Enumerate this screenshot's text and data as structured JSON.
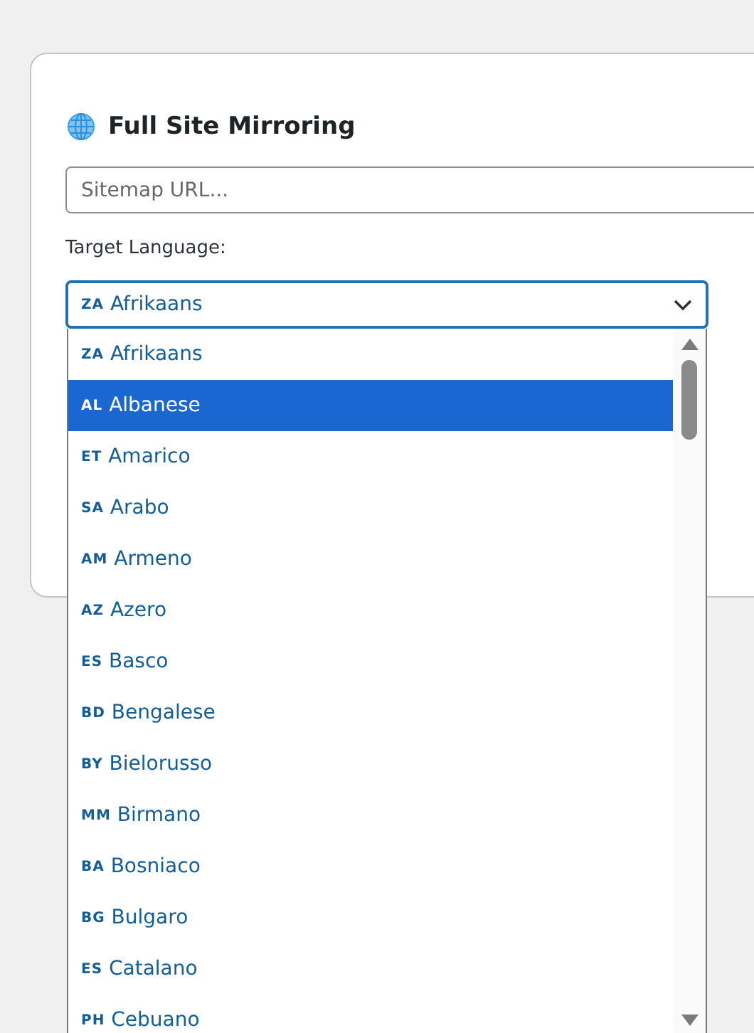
{
  "section": {
    "title": "Full Site Mirroring"
  },
  "sitemap_field": {
    "placeholder": "Sitemap URL..."
  },
  "target_language": {
    "label": "Target Language:",
    "value": {
      "code": "ZA",
      "name": "Afrikaans"
    },
    "expanded": true,
    "options": [
      {
        "code": "ZA",
        "name": "Afrikaans",
        "selected": false
      },
      {
        "code": "AL",
        "name": "Albanese",
        "selected": true
      },
      {
        "code": "ET",
        "name": "Amarico",
        "selected": false
      },
      {
        "code": "SA",
        "name": "Arabo",
        "selected": false
      },
      {
        "code": "AM",
        "name": "Armeno",
        "selected": false
      },
      {
        "code": "AZ",
        "name": "Azero",
        "selected": false
      },
      {
        "code": "ES",
        "name": "Basco",
        "selected": false
      },
      {
        "code": "BD",
        "name": "Bengalese",
        "selected": false
      },
      {
        "code": "BY",
        "name": "Bielorusso",
        "selected": false
      },
      {
        "code": "MM",
        "name": "Birmano",
        "selected": false
      },
      {
        "code": "BA",
        "name": "Bosniaco",
        "selected": false
      },
      {
        "code": "BG",
        "name": "Bulgaro",
        "selected": false
      },
      {
        "code": "ES",
        "name": "Catalano",
        "selected": false
      },
      {
        "code": "PH",
        "name": "Cebuano",
        "selected": false
      }
    ]
  }
}
